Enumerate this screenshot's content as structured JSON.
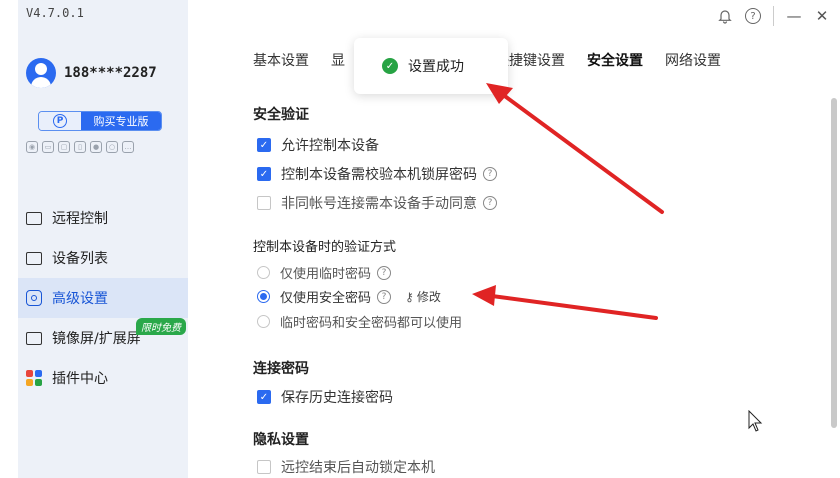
{
  "app": {
    "version": "V4.7.0.1"
  },
  "user": {
    "name": "188****2287"
  },
  "pro": {
    "p_letter": "P",
    "buy_label": "购买专业版"
  },
  "sidebar": {
    "items": [
      {
        "label": "远程控制",
        "icon": "remote-control-icon"
      },
      {
        "label": "设备列表",
        "icon": "device-list-icon"
      },
      {
        "label": "高级设置",
        "icon": "advanced-settings-icon",
        "active": true
      },
      {
        "label": "镜像屏/扩展屏",
        "icon": "mirror-screen-icon",
        "badge": "限时免费"
      },
      {
        "label": "插件中心",
        "icon": "plugin-center-icon"
      }
    ]
  },
  "titlebar": {
    "help_glyph": "?",
    "minimize_glyph": "—",
    "close_glyph": "✕"
  },
  "tabs": [
    {
      "label": "基本设置",
      "active": false
    },
    {
      "label": "显",
      "active": false
    },
    {
      "label": "快捷键设置",
      "active": false
    },
    {
      "label": "安全设置",
      "active": true
    },
    {
      "label": "网络设置",
      "active": false
    }
  ],
  "toast": {
    "message": "设置成功"
  },
  "security": {
    "section_title": "安全验证",
    "options": [
      {
        "label": "允许控制本设备",
        "checked": true
      },
      {
        "label": "控制本设备需校验本机锁屏密码",
        "checked": true,
        "help": true
      },
      {
        "label": "非同帐号连接需本设备手动同意",
        "checked": false,
        "help": true
      }
    ]
  },
  "verify_method": {
    "section_title": "控制本设备时的验证方式",
    "options": [
      {
        "label": "仅使用临时密码",
        "selected": false,
        "help": true
      },
      {
        "label": "仅使用安全密码",
        "selected": true,
        "help": true,
        "modify_label": "修改"
      },
      {
        "label": "临时密码和安全密码都可以使用",
        "selected": false
      }
    ]
  },
  "connect_password": {
    "section_title": "连接密码",
    "options": [
      {
        "label": "保存历史连接密码",
        "checked": true
      }
    ]
  },
  "privacy": {
    "section_title": "隐私设置",
    "options": [
      {
        "label": "远控结束后自动锁定本机",
        "checked": false
      }
    ]
  },
  "colors": {
    "accent": "#2b6af0",
    "success": "#27a344",
    "annotation_arrow": "#e02424",
    "free_badge": "#2aa84a"
  }
}
